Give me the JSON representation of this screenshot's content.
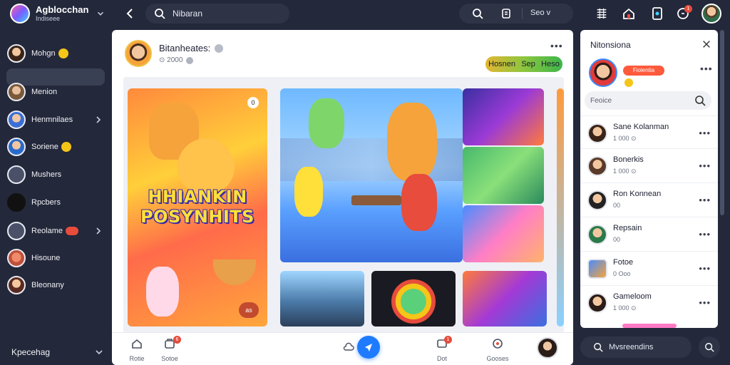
{
  "app": {
    "title": "Agblocchan",
    "subtitle": "Indiseee"
  },
  "topbar": {
    "search_label": "Nibaran",
    "sort_label": "Seo v",
    "notif_count": "1"
  },
  "sidebar": {
    "items": [
      {
        "label": "Mohgn"
      },
      {
        "label": ""
      },
      {
        "label": "Menion"
      },
      {
        "label": "Henmnilaes"
      },
      {
        "label": "Soriene"
      },
      {
        "label": "Mushers"
      },
      {
        "label": "Rpcbers"
      },
      {
        "label": "Reolame"
      },
      {
        "label": "Hisoune"
      },
      {
        "label": "Bleonany"
      }
    ],
    "footer_label": "Kpecehag"
  },
  "post": {
    "title": "Bitanheates:",
    "meta": "⊙ 2000",
    "tag_left": "Hosnen",
    "tag_mid": "Sep",
    "tag_right": "Heso",
    "hero_title": "HHIANKIN POSYNHITS",
    "hero_badge": "0",
    "hero_rate": "as"
  },
  "bottom_nav": [
    {
      "label": "Rotie"
    },
    {
      "label": "Sotoe",
      "badge": "6"
    },
    {
      "label": "Dot",
      "badge": "1"
    },
    {
      "label": "Gooses"
    }
  ],
  "right_panel": {
    "title": "Nitonsiona",
    "profile_tag": "Fiolentia",
    "search_placeholder": "Feoice",
    "rows": [
      {
        "name": "Sane Kolanman",
        "sub": "1 000 ⊙"
      },
      {
        "name": "Bonerkis",
        "sub": "1 000 ⊙"
      },
      {
        "name": "Ron Konnean",
        "sub": "00"
      },
      {
        "name": "Repsain",
        "sub": "00"
      },
      {
        "name": "Fotoe",
        "sub": "0   Ooo"
      },
      {
        "name": "Gameloom",
        "sub": "1 000 ⊙"
      }
    ],
    "bottom_search": "Mvsreendins"
  },
  "colors": {
    "bg": "#23283a",
    "accent": "#1e7bff",
    "badge": "#e74c3c"
  }
}
